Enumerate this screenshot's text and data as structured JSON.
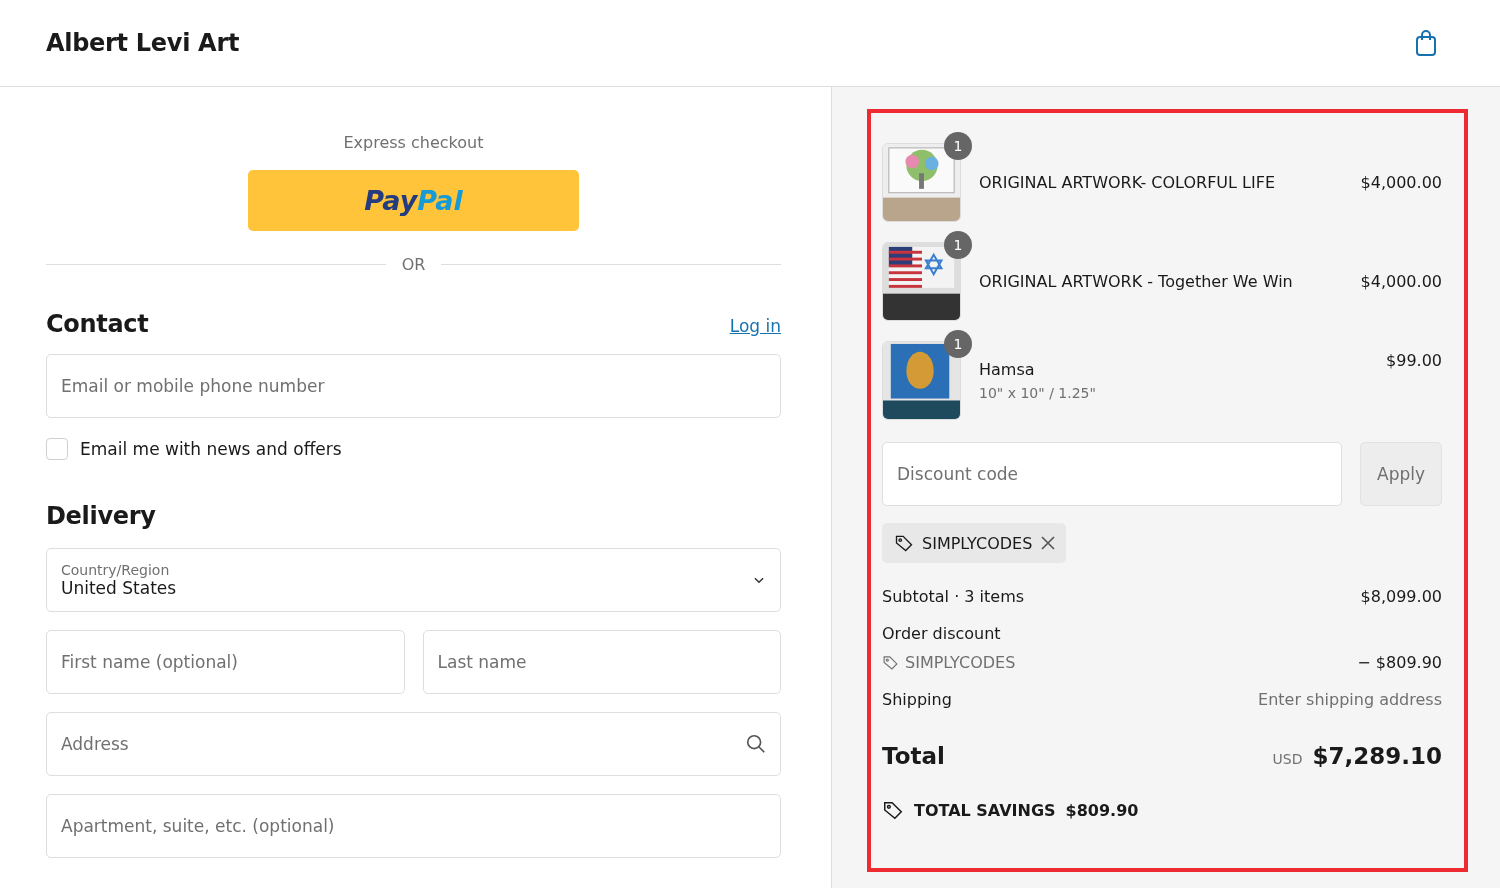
{
  "header": {
    "store_name": "Albert Levi Art"
  },
  "express": {
    "title": "Express checkout",
    "paypal_logo": [
      "Pay",
      "Pal"
    ],
    "divider": "OR"
  },
  "contact": {
    "heading": "Contact",
    "login_link": "Log in",
    "email_placeholder": "Email or mobile phone number",
    "newsletter": {
      "label": "Email me with news and offers",
      "checked": false
    }
  },
  "delivery": {
    "heading": "Delivery",
    "country": {
      "label": "Country/Region",
      "value": "United States"
    },
    "fields": [
      {
        "kind": "pair",
        "placeholders": [
          "First name (optional)",
          "Last name"
        ]
      },
      {
        "kind": "search",
        "placeholders": [
          "Address"
        ]
      },
      {
        "kind": "single",
        "placeholders": [
          "Apartment, suite, etc. (optional)"
        ]
      }
    ]
  },
  "summary": {
    "highlighted": true,
    "items": [
      {
        "title": "ORIGINAL ARTWORK- COLORFUL LIFE",
        "quantity": "1",
        "price": "$4,000.00"
      },
      {
        "title": "ORIGINAL ARTWORK - Together We Win",
        "quantity": "1",
        "price": "$4,000.00"
      },
      {
        "title": "Hamsa",
        "variant": "10\" x 10\" / 1.25\"",
        "quantity": "1",
        "price": "$99.00"
      }
    ],
    "discount_placeholder": "Discount code",
    "apply_button": "Apply",
    "applied_code": "SIMPLYCODES",
    "subtotal": {
      "label": "Subtotal · 3 items",
      "value": "$8,099.00"
    },
    "order_discount": {
      "label": "Order discount",
      "code": "SIMPLYCODES",
      "value": "− $809.90"
    },
    "shipping": {
      "label": "Shipping",
      "value": "Enter shipping address"
    },
    "total": {
      "label": "Total",
      "currency": "USD",
      "value": "$7,289.10"
    },
    "savings": {
      "label": "TOTAL SAVINGS",
      "value": "$809.90"
    }
  }
}
